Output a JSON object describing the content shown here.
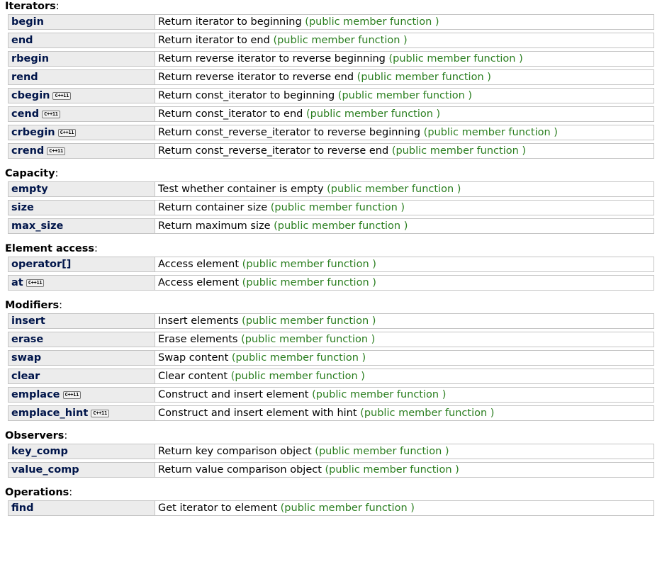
{
  "kind_label": "(public member function )",
  "badge_label": "C++11",
  "sections": [
    {
      "title": "Iterators",
      "rows": [
        {
          "name": "begin",
          "desc": "Return iterator to beginning",
          "cxx11": false
        },
        {
          "name": "end",
          "desc": "Return iterator to end",
          "cxx11": false
        },
        {
          "name": "rbegin",
          "desc": "Return reverse iterator to reverse beginning",
          "cxx11": false
        },
        {
          "name": "rend",
          "desc": "Return reverse iterator to reverse end",
          "cxx11": false
        },
        {
          "name": "cbegin",
          "desc": "Return const_iterator to beginning",
          "cxx11": true
        },
        {
          "name": "cend",
          "desc": "Return const_iterator to end",
          "cxx11": true
        },
        {
          "name": "crbegin",
          "desc": "Return const_reverse_iterator to reverse beginning",
          "cxx11": true
        },
        {
          "name": "crend",
          "desc": "Return const_reverse_iterator to reverse end",
          "cxx11": true
        }
      ]
    },
    {
      "title": "Capacity",
      "rows": [
        {
          "name": "empty",
          "desc": "Test whether container is empty",
          "cxx11": false
        },
        {
          "name": "size",
          "desc": "Return container size",
          "cxx11": false
        },
        {
          "name": "max_size",
          "desc": "Return maximum size",
          "cxx11": false
        }
      ]
    },
    {
      "title": "Element access",
      "rows": [
        {
          "name": "operator[]",
          "desc": "Access element",
          "cxx11": false
        },
        {
          "name": "at",
          "desc": "Access element",
          "cxx11": true
        }
      ]
    },
    {
      "title": "Modifiers",
      "rows": [
        {
          "name": "insert",
          "desc": "Insert elements",
          "cxx11": false
        },
        {
          "name": "erase",
          "desc": "Erase elements",
          "cxx11": false
        },
        {
          "name": "swap",
          "desc": "Swap content",
          "cxx11": false
        },
        {
          "name": "clear",
          "desc": "Clear content",
          "cxx11": false
        },
        {
          "name": "emplace",
          "desc": "Construct and insert element",
          "cxx11": true
        },
        {
          "name": "emplace_hint",
          "desc": "Construct and insert element with hint",
          "cxx11": true
        }
      ]
    },
    {
      "title": "Observers",
      "rows": [
        {
          "name": "key_comp",
          "desc": "Return key comparison object",
          "cxx11": false
        },
        {
          "name": "value_comp",
          "desc": "Return value comparison object",
          "cxx11": false
        }
      ]
    },
    {
      "title": "Operations",
      "rows": [
        {
          "name": "find",
          "desc": "Get iterator to element",
          "cxx11": false
        }
      ]
    }
  ]
}
